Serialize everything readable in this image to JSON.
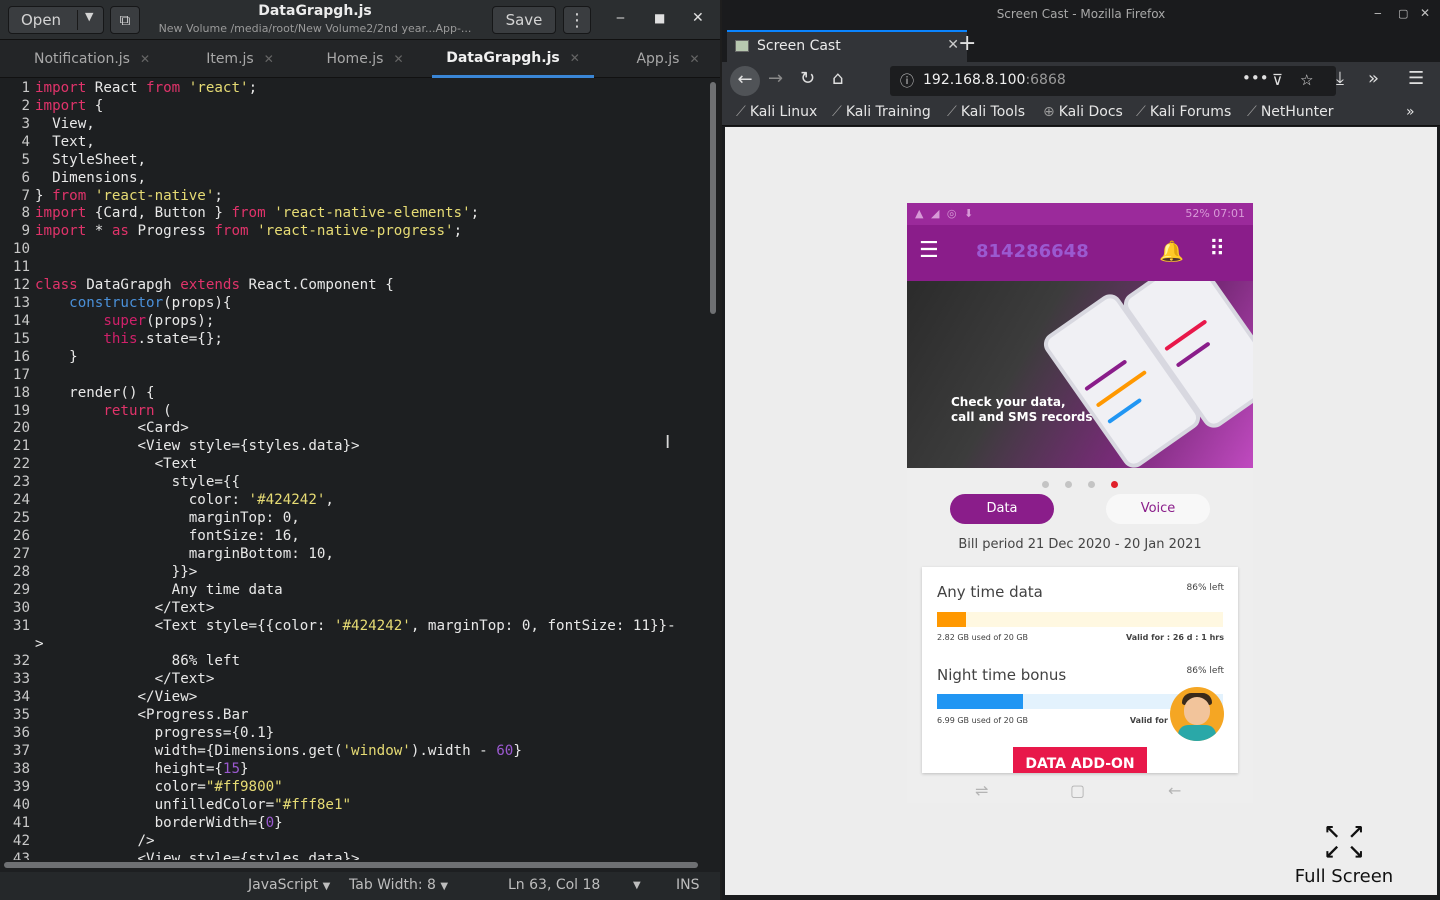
{
  "editor": {
    "open_label": "Open",
    "title": "DataGrapgh.js",
    "subtitle": "New Volume /media/root/New Volume2/2nd year...App-...",
    "save_label": "Save",
    "tabs": [
      {
        "label": "Notification.js"
      },
      {
        "label": "Item.js"
      },
      {
        "label": "Home.js"
      },
      {
        "label": "DataGrapgh.js",
        "active": true
      },
      {
        "label": "App.js"
      }
    ],
    "code_lines": [
      {
        "n": "1",
        "html": "<span class='kw'>import</span> React <span class='kw'>from</span> <span class='str'>'react'</span>;"
      },
      {
        "n": "2",
        "html": "<span class='kw'>import</span> {"
      },
      {
        "n": "3",
        "html": "  View,"
      },
      {
        "n": "4",
        "html": "  Text,"
      },
      {
        "n": "5",
        "html": "  StyleSheet,"
      },
      {
        "n": "6",
        "html": "  Dimensions,"
      },
      {
        "n": "7",
        "html": "} <span class='kw'>from</span> <span class='str'>'react-native'</span>;"
      },
      {
        "n": "8",
        "html": "<span class='kw'>import</span> {Card, Button } <span class='kw'>from</span> <span class='str'>'react-native-elements'</span>;"
      },
      {
        "n": "9",
        "html": "<span class='kw'>import</span> * <span class='kw'>as</span> Progress <span class='kw'>from</span> <span class='str'>'react-native-progress'</span>;"
      },
      {
        "n": "10",
        "html": ""
      },
      {
        "n": "11",
        "html": ""
      },
      {
        "n": "12",
        "html": "<span class='kw'>class</span> DataGrapgh <span class='kw'>extends</span> React.Component {"
      },
      {
        "n": "13",
        "html": "    <span class='fn'>constructor</span>(props){"
      },
      {
        "n": "14",
        "html": "        <span class='kw2'>super</span>(props);"
      },
      {
        "n": "15",
        "html": "        <span class='kw2'>this</span>.state={};"
      },
      {
        "n": "16",
        "html": "    }"
      },
      {
        "n": "17",
        "html": ""
      },
      {
        "n": "18",
        "html": "    render() {"
      },
      {
        "n": "19",
        "html": "        <span class='kw'>return</span> ("
      },
      {
        "n": "20",
        "html": "            &lt;Card&gt;"
      },
      {
        "n": "21",
        "html": "            &lt;View style={styles.data}&gt;"
      },
      {
        "n": "22",
        "html": "              &lt;Text"
      },
      {
        "n": "23",
        "html": "                style={{"
      },
      {
        "n": "24",
        "html": "                  color: <span class='str'>'#424242'</span>,"
      },
      {
        "n": "25",
        "html": "                  marginTop: 0,"
      },
      {
        "n": "26",
        "html": "                  fontSize: 16,"
      },
      {
        "n": "27",
        "html": "                  marginBottom: 10,"
      },
      {
        "n": "28",
        "html": "                }}&gt;"
      },
      {
        "n": "29",
        "html": "                Any time data"
      },
      {
        "n": "30",
        "html": "              &lt;/Text&gt;"
      },
      {
        "n": "31",
        "html": "              &lt;Text style={{color: <span class='str'>'#424242'</span>, marginTop: 0, fontSize: 11}}-"
      },
      {
        "n": "",
        "html": "&gt;"
      },
      {
        "n": "32",
        "html": "                86% left"
      },
      {
        "n": "33",
        "html": "              &lt;/Text&gt;"
      },
      {
        "n": "34",
        "html": "            &lt;/View&gt;"
      },
      {
        "n": "35",
        "html": "            &lt;Progress.Bar"
      },
      {
        "n": "36",
        "html": "              progress={0.1}"
      },
      {
        "n": "37",
        "html": "              width={Dimensions.get(<span class='str'>'window'</span>).width - <span class='num'>60</span>}"
      },
      {
        "n": "38",
        "html": "              height={<span class='num'>15</span>}"
      },
      {
        "n": "39",
        "html": "              color=<span class='str'>\"#ff9800\"</span>"
      },
      {
        "n": "40",
        "html": "              unfilledColor=<span class='str'>\"#fff8e1\"</span>"
      },
      {
        "n": "41",
        "html": "              borderWidth={<span class='num'>0</span>}"
      },
      {
        "n": "42",
        "html": "            /&gt;"
      },
      {
        "n": "43",
        "html": "            &lt;View style={styles.data}&gt;"
      }
    ],
    "status": {
      "language": "JavaScript",
      "tab_width": "Tab Width: 8",
      "position": "Ln 63, Col 18",
      "mode": "INS"
    }
  },
  "firefox": {
    "window_title": "Screen Cast - Mozilla Firefox",
    "tab_title": "Screen Cast",
    "url_host": "192.168.8.100",
    "url_port": ":6868",
    "bookmarks": [
      "Kali Linux",
      "Kali Training",
      "Kali Tools",
      "Kali Docs",
      "Kali Forums",
      "NetHunter"
    ],
    "fullscreen_label": "Full Screen"
  },
  "phone": {
    "status_right": "52% 07:01",
    "number": "814286648",
    "banner_text": [
      "Check your data,",
      "call and SMS records"
    ],
    "data_tab": "Data",
    "voice_tab": "Voice",
    "bill_period": "Bill period 21 Dec 2020 - 20 Jan 2021",
    "usage": [
      {
        "title": "Any time data",
        "left": "86% left",
        "used": "2.82 GB used of 20 GB",
        "valid": "Valid for : 26 d : 1 hrs",
        "progress": 0.1,
        "color": "#ff9800",
        "track": "#fff8e1"
      },
      {
        "title": "Night time bonus",
        "left": "86% left",
        "used": "6.99 GB used of 20 GB",
        "valid": "Valid for",
        "progress": 0.3,
        "color": "#2196f3",
        "track": "#e3f2fd"
      }
    ],
    "addon_label": "DATA ADD-ON"
  },
  "colors": {
    "accent_purple": "#8a1d8a",
    "addon_red": "#e8184a",
    "tab_underline": "#3a86d6"
  }
}
